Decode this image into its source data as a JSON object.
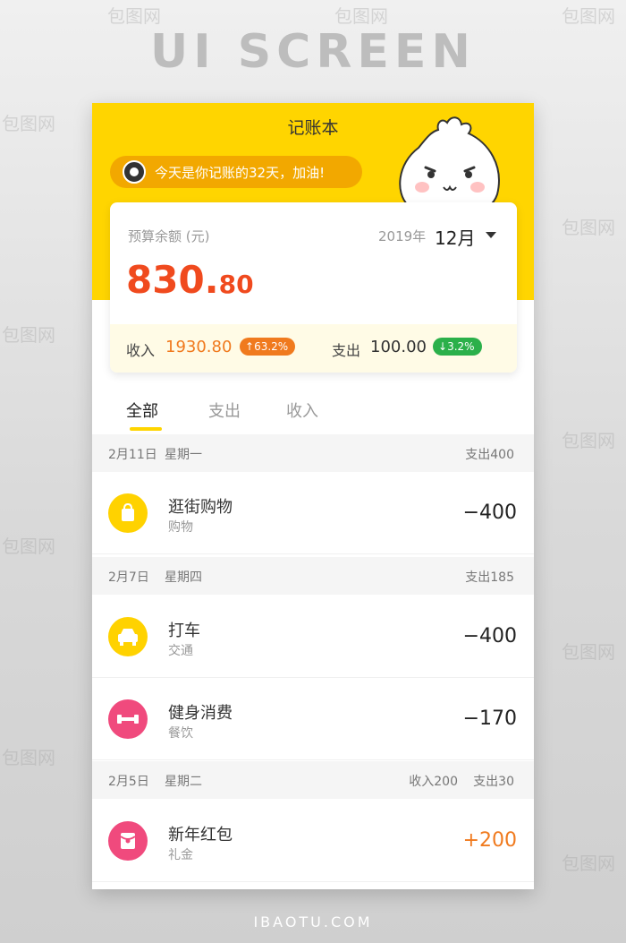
{
  "watermark": "包图网",
  "headline": "UI SCREEN",
  "footer": "IBAOTU.COM",
  "app": {
    "title": "记账本",
    "banner": "今天是你记账的32天，加油!"
  },
  "card": {
    "budget_label": "预算余额 (元)",
    "year": "2019年",
    "month": "12月",
    "amount_int": "830.",
    "amount_dec": "80",
    "income_label": "收入",
    "income_value": "1930.80",
    "income_change": "63.2%",
    "expense_label": "支出",
    "expense_value": "100.00",
    "expense_change": "3.2%"
  },
  "tabs": [
    {
      "label": "全部",
      "active": true
    },
    {
      "label": "支出",
      "active": false
    },
    {
      "label": "收入",
      "active": false
    }
  ],
  "groups": [
    {
      "date": "2月11日",
      "week": "星期一",
      "expense": "支出400",
      "income": "",
      "items": [
        {
          "name": "逛街购物",
          "category": "购物",
          "amount": "−400",
          "icon": "shopping-bag-icon",
          "color": "#ffd200"
        }
      ]
    },
    {
      "date": "2月7日",
      "week": "星期四",
      "expense": "支出185",
      "income": "",
      "items": [
        {
          "name": "打车",
          "category": "交通",
          "amount": "−400",
          "icon": "car-icon",
          "color": "#ffd200"
        },
        {
          "name": "健身消费",
          "category": "餐饮",
          "amount": "−170",
          "icon": "dumbbell-icon",
          "color": "#f04a7d"
        }
      ]
    },
    {
      "date": "2月5日",
      "week": "星期二",
      "expense": "支出30",
      "income": "收入200",
      "items": [
        {
          "name": "新年红包",
          "category": "礼金",
          "amount": "+200",
          "icon": "red-envelope-icon",
          "color": "#f04a7d"
        }
      ]
    }
  ],
  "colors": {
    "brand": "#ffd500",
    "banner": "#f2a800",
    "amount": "#f04a1e",
    "income": "#f07a1e",
    "decrease": "#2bb04a"
  }
}
